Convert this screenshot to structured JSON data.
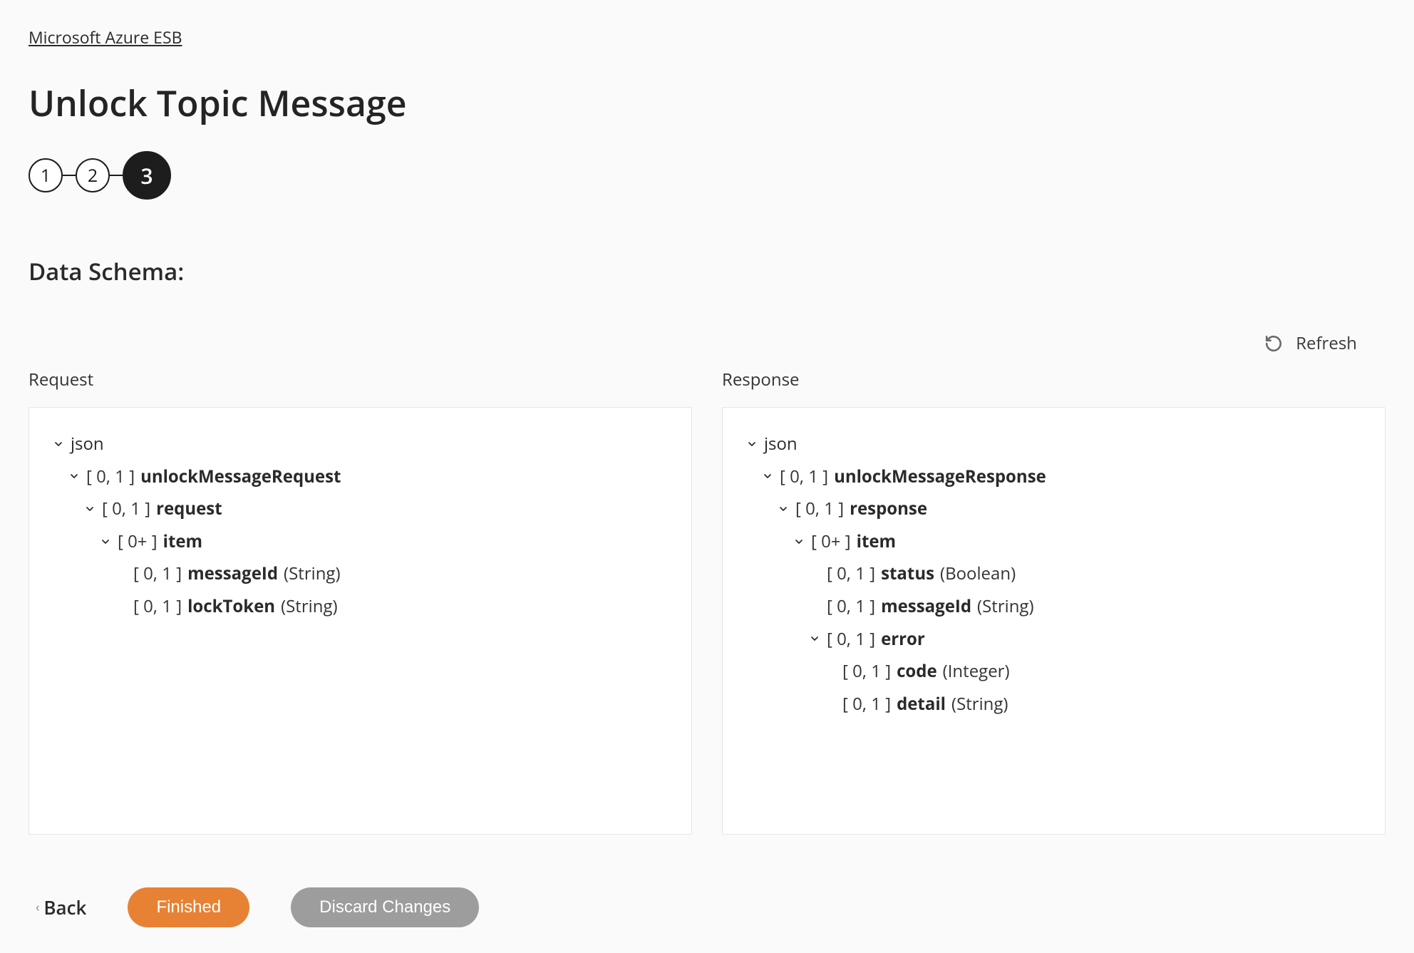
{
  "breadcrumb": "Microsoft Azure ESB",
  "page_title": "Unlock Topic Message",
  "stepper": {
    "steps": [
      "1",
      "2",
      "3"
    ],
    "active_index": 2
  },
  "section_title": "Data Schema:",
  "refresh_label": "Refresh",
  "panels": {
    "request": {
      "label": "Request",
      "root_label": "json",
      "nodes": [
        {
          "indent": 1,
          "chevron": true,
          "card": "[ 0, 1 ]",
          "name": "unlockMessageRequest"
        },
        {
          "indent": 2,
          "chevron": true,
          "card": "[ 0, 1 ]",
          "name": "request"
        },
        {
          "indent": 3,
          "chevron": true,
          "card": "[ 0+ ]",
          "name": "item"
        },
        {
          "indent": 4,
          "chevron": false,
          "card": "[ 0, 1 ]",
          "name": "messageId",
          "type": "(String)"
        },
        {
          "indent": 4,
          "chevron": false,
          "card": "[ 0, 1 ]",
          "name": "lockToken",
          "type": "(String)"
        }
      ]
    },
    "response": {
      "label": "Response",
      "root_label": "json",
      "nodes": [
        {
          "indent": 1,
          "chevron": true,
          "card": "[ 0, 1 ]",
          "name": "unlockMessageResponse"
        },
        {
          "indent": 2,
          "chevron": true,
          "card": "[ 0, 1 ]",
          "name": "response"
        },
        {
          "indent": 3,
          "chevron": true,
          "card": "[ 0+ ]",
          "name": "item"
        },
        {
          "indent": 4,
          "chevron": false,
          "card": "[ 0, 1 ]",
          "name": "status",
          "type": "(Boolean)"
        },
        {
          "indent": 4,
          "chevron": false,
          "card": "[ 0, 1 ]",
          "name": "messageId",
          "type": "(String)"
        },
        {
          "indent": 4,
          "chevron": true,
          "card": "[ 0, 1 ]",
          "name": "error"
        },
        {
          "indent": 5,
          "chevron": false,
          "card": "[ 0, 1 ]",
          "name": "code",
          "type": "(Integer)"
        },
        {
          "indent": 5,
          "chevron": false,
          "card": "[ 0, 1 ]",
          "name": "detail",
          "type": "(String)"
        }
      ]
    }
  },
  "footer": {
    "back": "Back",
    "finished": "Finished",
    "discard": "Discard Changes"
  }
}
